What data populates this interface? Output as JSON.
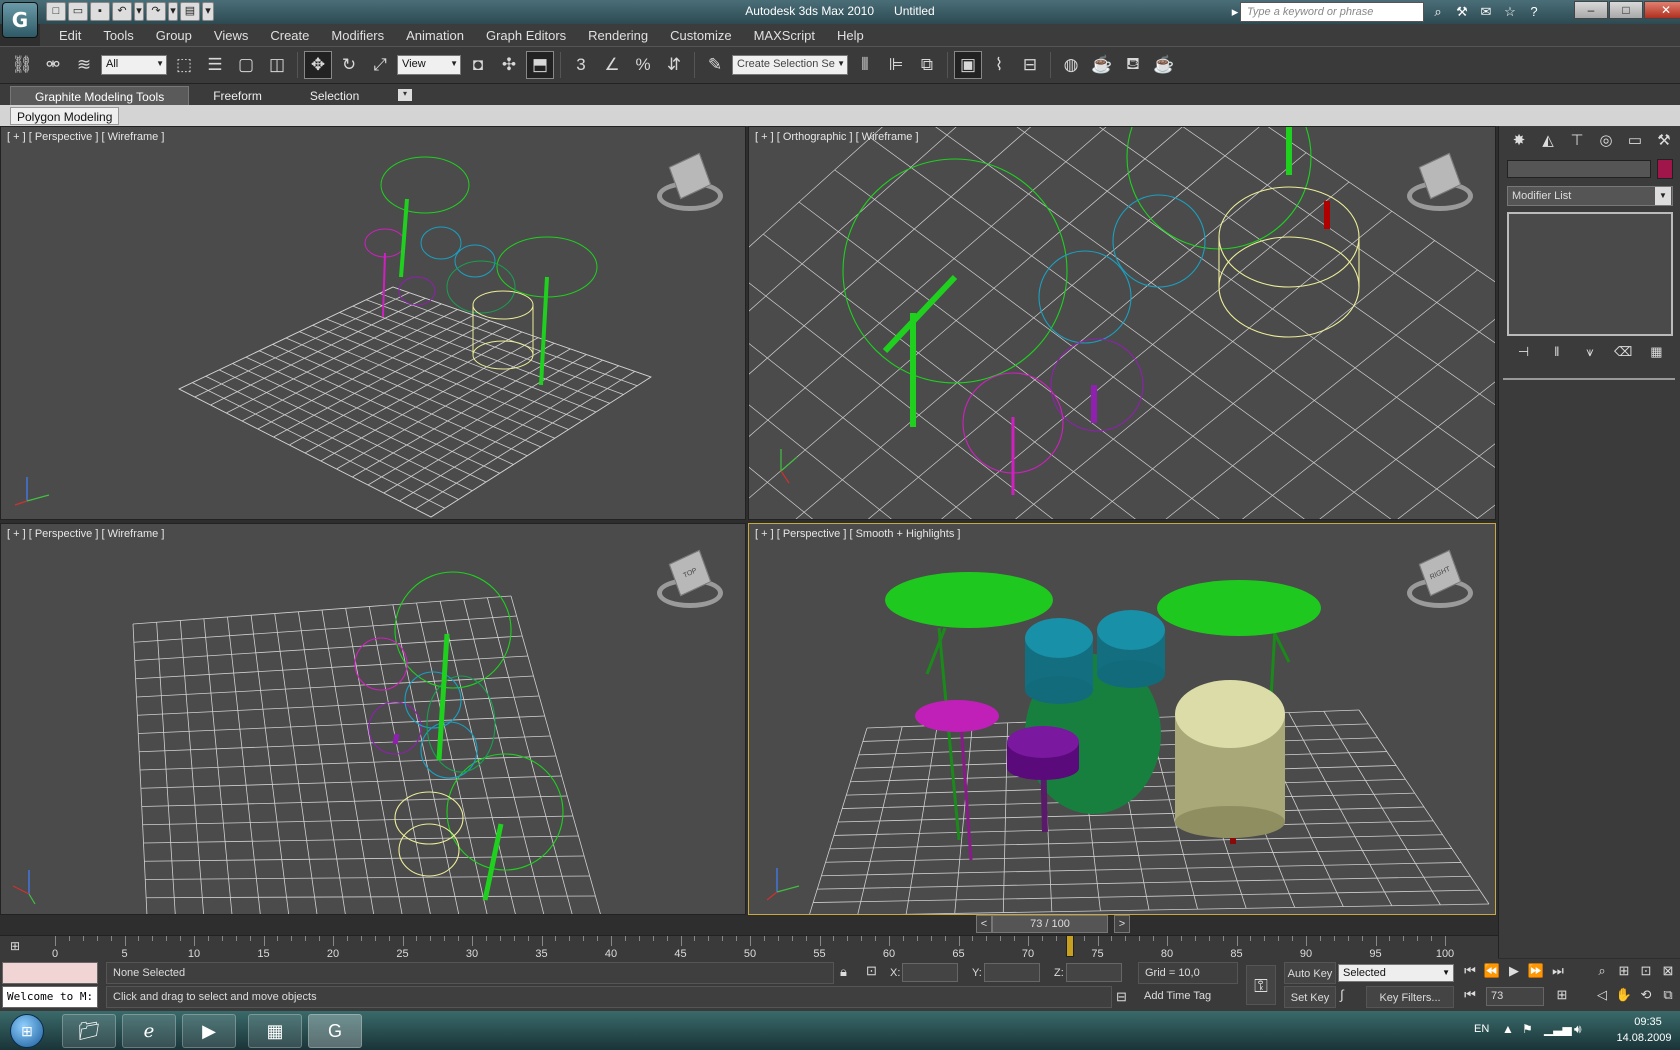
{
  "window": {
    "app_title": "Autodesk 3ds Max  2010",
    "doc_title": "Untitled",
    "search_placeholder": "Type a keyword or phrase",
    "logo": "G",
    "minimize": "–",
    "maximize": "□",
    "close": "✕"
  },
  "quick_access": [
    "new-icon",
    "open-icon",
    "save-icon",
    "undo-icon",
    "redo-icon",
    "project-icon"
  ],
  "menu": [
    "Edit",
    "Tools",
    "Group",
    "Views",
    "Create",
    "Modifiers",
    "Animation",
    "Graph Editors",
    "Rendering",
    "Customize",
    "MAXScript",
    "Help"
  ],
  "toolbar": {
    "filter_value": "All",
    "refcoord_value": "View",
    "selection_set_placeholder": "Create Selection Se",
    "snap_label": "3",
    "angle_snap_label": "∠",
    "percent_snap_label": "%"
  },
  "ribbon": {
    "tabs": [
      "Graphite Modeling Tools",
      "Freeform",
      "Selection"
    ],
    "panel_label": "Polygon Modeling"
  },
  "viewports": {
    "top_left": "[ + ] [ Perspective ] [ Wireframe ]",
    "top_right": "[ + ] [ Orthographic ] [ Wireframe ]",
    "bottom_left": "[ + ] [ Perspective ] [ Wireframe ]",
    "bottom_right": "[ + ] [ Perspective ] [ Smooth + Highlights ]",
    "viewcube_top": "TOP",
    "viewcube_right": "RIGHT"
  },
  "command_panel": {
    "modifier_list": "Modifier List",
    "object_color": "#a0154a"
  },
  "timeline": {
    "frame_display": "73 / 100",
    "prev": "<",
    "next": ">",
    "current_frame": 73,
    "total_frames": 100,
    "tick_labels": [
      "0",
      "5",
      "10",
      "15",
      "20",
      "25",
      "30",
      "35",
      "40",
      "45",
      "50",
      "55",
      "60",
      "65",
      "70",
      "75",
      "80",
      "85",
      "90",
      "95",
      "100"
    ]
  },
  "status": {
    "listener_text": "Welcome to M:",
    "selection": "None Selected",
    "prompt": "Click and drag to select and move objects",
    "x_label": "X:",
    "y_label": "Y:",
    "z_label": "Z:",
    "grid": "Grid = 10,0",
    "add_time_tag": "Add Time Tag",
    "auto_key": "Auto Key",
    "set_key": "Set Key",
    "key_mode": "Selected",
    "key_filters": "Key Filters...",
    "frame_value": "73"
  },
  "taskbar": {
    "language": "EN",
    "time": "09:35",
    "date": "14.08.2009"
  },
  "colors": {
    "cymbal_green": "#1fd01f",
    "tom_blue": "#1aa0c0",
    "hihat_magenta": "#d020c0",
    "snare_purple": "#9020b0",
    "floor_tom_yellow": "#eeee99",
    "kick_green": "#18a050",
    "leg_red": "#b00000"
  }
}
